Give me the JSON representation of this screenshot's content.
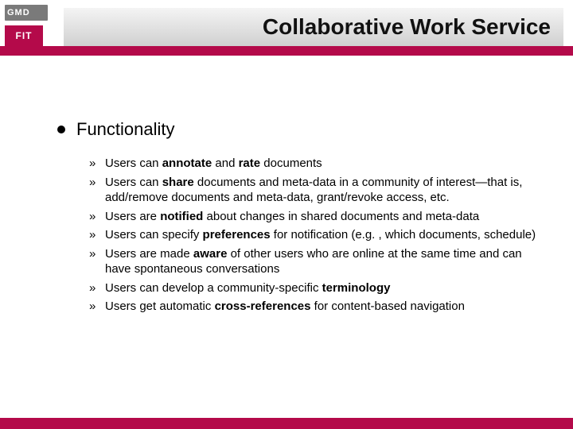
{
  "logo": {
    "top": "GMD",
    "bottom": "FIT"
  },
  "title": "Collaborative Work Service",
  "heading": "Functionality",
  "bullets": [
    "Users can <b>annotate</b> and <b>rate</b> documents",
    "Users can <b>share</b> documents and meta-data in a community of interest—that is, add/remove documents and meta-data, grant/revoke access, etc.",
    "Users are <b>notified</b> about changes in shared documents and meta-data",
    "Users can specify <b>preferences</b> for notification (e.g. , which documents, schedule)",
    "Users are made <b>aware</b> of other users who are online at the same time and can have spontaneous conversations",
    "Users can develop a community-specific <b>terminology</b>",
    "Users get automatic <b>cross-references</b> for content-based navigation"
  ]
}
